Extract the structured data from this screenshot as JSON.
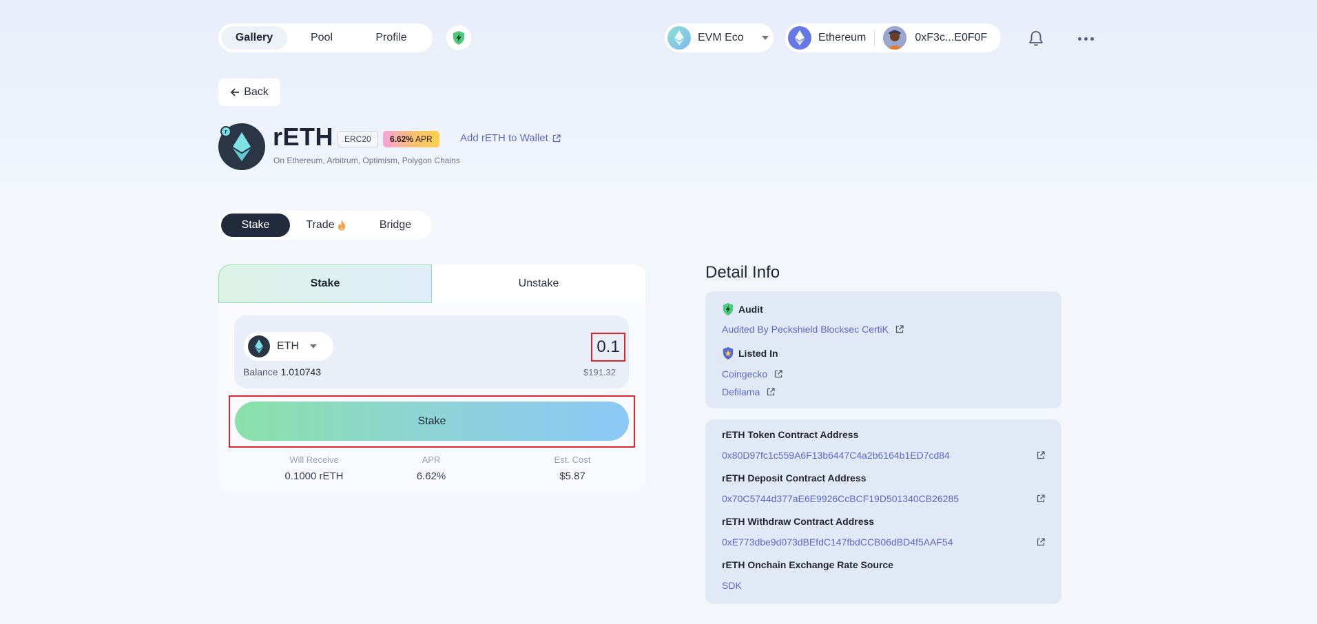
{
  "nav": {
    "tabs": [
      {
        "label": "Gallery",
        "active": true
      },
      {
        "label": "Pool",
        "active": false
      },
      {
        "label": "Profile",
        "active": false
      }
    ],
    "ecosystem": "EVM Eco",
    "network": "Ethereum",
    "wallet": "0xF3c...E0F0F"
  },
  "back_label": "Back",
  "token": {
    "symbol": "rETH",
    "standard": "ERC20",
    "apr_value": "6.62%",
    "apr_label": "APR",
    "add_wallet": "Add rETH to Wallet",
    "chains": "On Ethereum, Arbitrum, Optimism, Polygon Chains"
  },
  "action_tabs": {
    "stake": "Stake",
    "trade": "Trade",
    "bridge": "Bridge"
  },
  "stake_card": {
    "seg_stake": "Stake",
    "seg_unstake": "Unstake",
    "input_token": "ETH",
    "amount": "0.1",
    "balance_label": "Balance",
    "balance_value": "1.010743",
    "usd_value": "$191.32",
    "stake_button": "Stake",
    "stats": [
      {
        "label": "Will Receive",
        "value": "0.1000 rETH"
      },
      {
        "label": "APR",
        "value": "6.62%"
      },
      {
        "label": "Est. Cost",
        "value": "$5.87"
      }
    ]
  },
  "detail": {
    "title": "Detail Info",
    "audit_title": "Audit",
    "audit_text": "Audited By Peckshield Blocksec CertiK",
    "listed_title": "Listed In",
    "listed": [
      "Coingecko",
      "Defilama"
    ],
    "addresses": [
      {
        "label": "rETH Token Contract Address",
        "value": "0x80D97fc1c559A6F13b6447C4a2b6164b1ED7cd84"
      },
      {
        "label": "rETH Deposit Contract Address",
        "value": "0x70C5744d377aE6E9926CcBCF19D501340CB26285"
      },
      {
        "label": "rETH Withdraw Contract Address",
        "value": "0xE773dbe9d073dBEfdC147fbdCCB06dBD4f5AAF54"
      }
    ],
    "rate_source_label": "rETH Onchain Exchange Rate Source",
    "rate_source_value": "SDK"
  },
  "colors": {
    "accent_link": "#5b69c9",
    "highlight_red": "#e0242c",
    "dark_tab": "#222b3b"
  }
}
